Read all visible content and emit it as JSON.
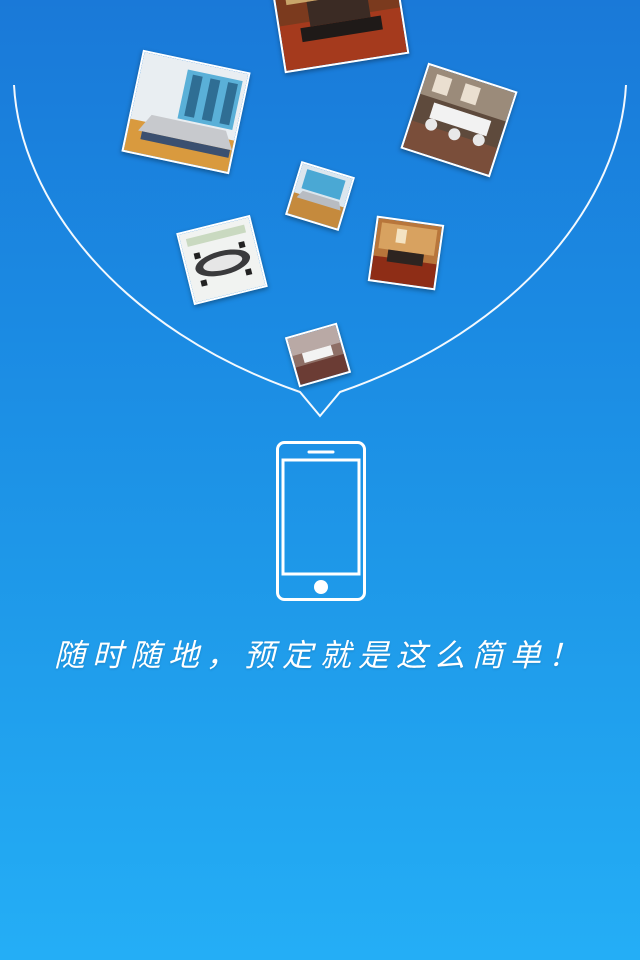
{
  "splash": {
    "slogan": "随时随地，预定就是这么简单！",
    "photo_icon": "meeting-room-photo",
    "device_icon": "smartphone-icon"
  },
  "colors": {
    "background_top": "#1a79d8",
    "background_bottom": "#24aef6",
    "outline": "#ffffff"
  }
}
